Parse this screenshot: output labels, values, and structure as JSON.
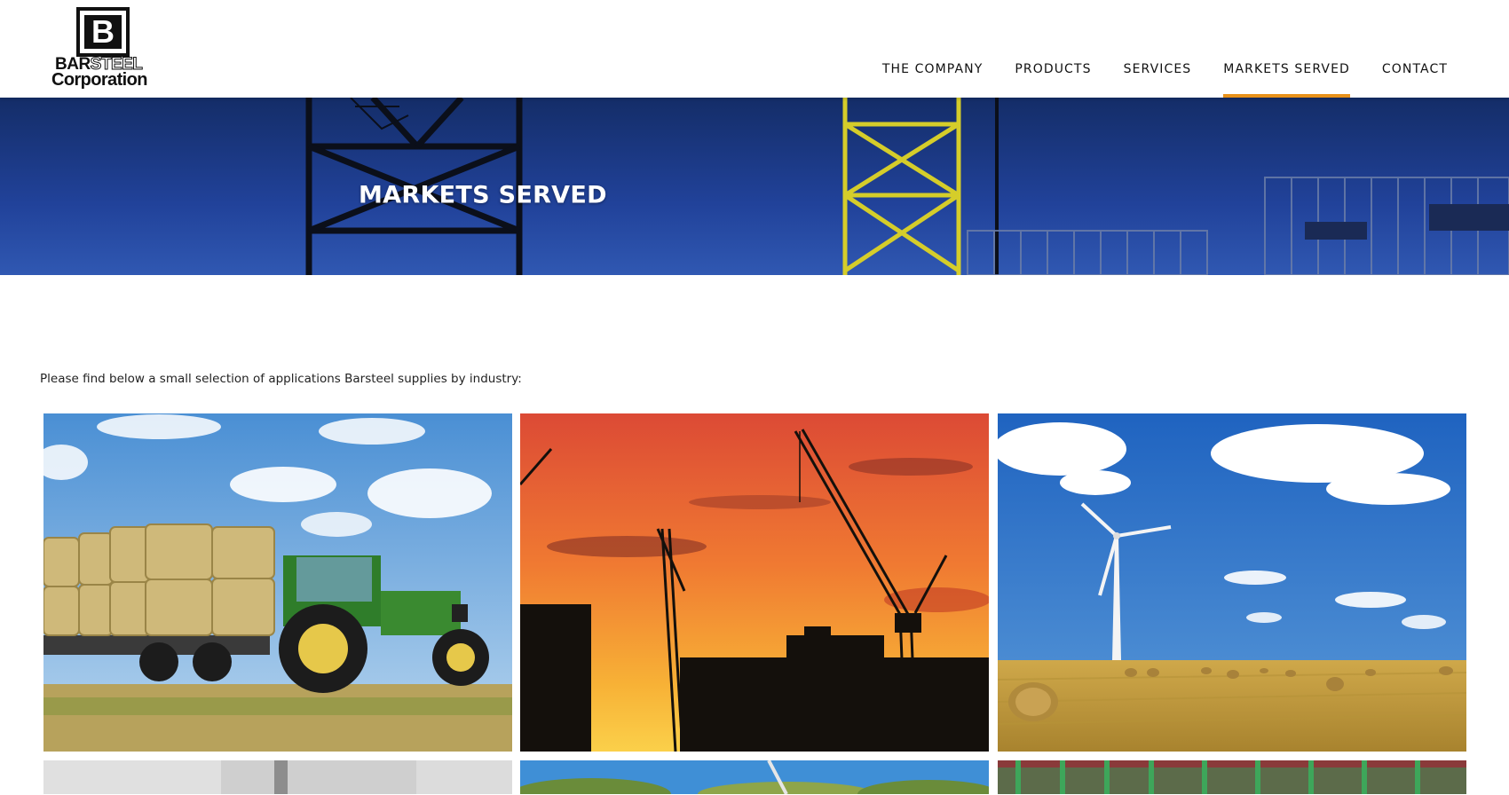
{
  "logo": {
    "mark_letter": "B",
    "line1_bar": "BAR",
    "line1_steel": "STEEL",
    "line2": "Corporation"
  },
  "nav": {
    "items": [
      {
        "label": "THE COMPANY",
        "active": false
      },
      {
        "label": "PRODUCTS",
        "active": false
      },
      {
        "label": "SERVICES",
        "active": false
      },
      {
        "label": "MARKETS SERVED",
        "active": true
      },
      {
        "label": "CONTACT",
        "active": false
      }
    ],
    "active_indicator_color": "#e8921a"
  },
  "hero": {
    "title": "MARKETS SERVED",
    "background": "#1f3f94"
  },
  "intro": {
    "text": "Please find below a small selection of applications Barsteel supplies by industry:"
  },
  "gallery": {
    "tiles": [
      {
        "subject": "tractor-hay-bales-photo"
      },
      {
        "subject": "construction-cranes-sunset-photo"
      },
      {
        "subject": "wind-turbine-field-photo"
      },
      {
        "subject": "interior-photo-partial"
      },
      {
        "subject": "trees-sky-photo-partial"
      },
      {
        "subject": "steel-structure-photo-partial"
      }
    ]
  }
}
